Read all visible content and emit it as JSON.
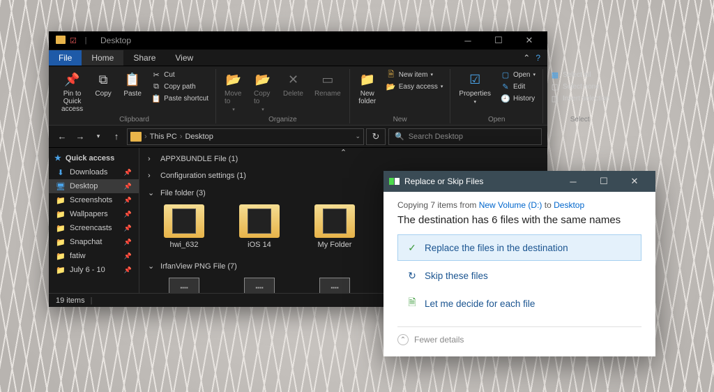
{
  "explorer": {
    "title": "Desktop",
    "menus": {
      "file": "File",
      "home": "Home",
      "share": "Share",
      "view": "View"
    },
    "ribbon": {
      "clipboard": {
        "label": "Clipboard",
        "pin": "Pin to Quick access",
        "copy": "Copy",
        "paste": "Paste",
        "cut": "Cut",
        "copy_path": "Copy path",
        "paste_shortcut": "Paste shortcut"
      },
      "organize": {
        "label": "Organize",
        "move_to": "Move to",
        "copy_to": "Copy to",
        "delete": "Delete",
        "rename": "Rename"
      },
      "new": {
        "label": "New",
        "new_folder": "New folder",
        "new_item": "New item",
        "easy_access": "Easy access"
      },
      "open": {
        "label": "Open",
        "properties": "Properties",
        "open": "Open",
        "edit": "Edit",
        "history": "History"
      },
      "select": {
        "label": "Select",
        "select_all": "Select all",
        "select_none": "Select none",
        "invert": "Invert selection"
      }
    },
    "nav": {
      "breadcrumb1": "This PC",
      "breadcrumb2": "Desktop",
      "search_placeholder": "Search Desktop"
    },
    "sidebar": {
      "quick_access": "Quick access",
      "items": [
        {
          "label": "Downloads",
          "icon": "⬇",
          "color": "#4aa3e8"
        },
        {
          "label": "Desktop",
          "icon": "🖥",
          "color": "#4aa3e8",
          "active": true
        },
        {
          "label": "Screenshots",
          "icon": "📁",
          "color": "#e8b44a"
        },
        {
          "label": "Wallpapers",
          "icon": "📁",
          "color": "#e8b44a"
        },
        {
          "label": "Screencasts",
          "icon": "📁",
          "color": "#e8b44a"
        },
        {
          "label": "Snapchat",
          "icon": "📁",
          "color": "#e8b44a"
        },
        {
          "label": "fatiw",
          "icon": "📁",
          "color": "#e8b44a"
        },
        {
          "label": "July 6 - 10",
          "icon": "📁",
          "color": "#e8b44a"
        }
      ]
    },
    "groups": [
      {
        "name": "APPXBUNDLE File (1)"
      },
      {
        "name": "Configuration settings (1)"
      },
      {
        "name": "File folder (3)",
        "folders": [
          {
            "label": "hwi_632"
          },
          {
            "label": "iOS 14"
          },
          {
            "label": "My Folder"
          }
        ]
      },
      {
        "name": "IrfanView PNG File (7)"
      }
    ],
    "status": "19 items"
  },
  "dialog": {
    "title": "Replace or Skip Files",
    "status_prefix": "Copying 7 items from ",
    "status_from": "New Volume (D:)",
    "status_mid": " to ",
    "status_to": "Desktop",
    "headline": "The destination has 6 files with the same names",
    "options": [
      {
        "label": "Replace the files in the destination",
        "icon": "✓",
        "color": "#3a9a3a",
        "highlight": true
      },
      {
        "label": "Skip these files",
        "icon": "↻",
        "color": "#1a5490"
      },
      {
        "label": "Let me decide for each file",
        "icon": "🗎",
        "color": "#3a9a3a"
      }
    ],
    "fewer_details": "Fewer details"
  }
}
